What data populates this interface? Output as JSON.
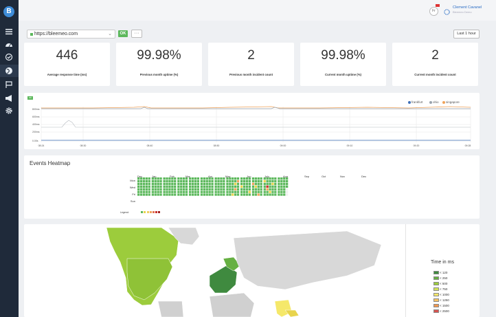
{
  "app": {
    "logo_text": "B",
    "user_name": "Clement Cavanel",
    "user_org": "Bleemeo Demo"
  },
  "sidebar": {
    "icons": [
      "menu-icon",
      "dashboard-icon",
      "check-circle-icon",
      "globe-icon",
      "flag-icon",
      "megaphone-icon",
      "gear-icon"
    ],
    "active": "globe-icon"
  },
  "controls": {
    "url_value": "https://bleemeo.com",
    "status": "OK",
    "more_label": "···",
    "time_range": "Last 1 hour"
  },
  "stats": [
    {
      "value": "446",
      "label": "Average response time (ms)"
    },
    {
      "value": "99.98%",
      "label": "Previous month uptime (%)"
    },
    {
      "value": "2",
      "label": "Previous month incident count"
    },
    {
      "value": "99.98%",
      "label": "Current month uptime (%)"
    },
    {
      "value": "2",
      "label": "Current month incident count"
    }
  ],
  "response_chart": {
    "status": "OK",
    "legend": [
      {
        "name": "frankfurt",
        "color": "#3e6fb8"
      },
      {
        "name": "ohio",
        "color": "#9aa3ad"
      },
      {
        "name": "singapore",
        "color": "#f0a35a"
      }
    ],
    "y_ticks": [
      "800ms",
      "600ms",
      "400ms",
      "200ms",
      "0.00s"
    ],
    "x_ticks": [
      "08:24",
      "08:30",
      "08:40",
      "08:50",
      "09:00",
      "09:10",
      "09:20",
      "09:28"
    ]
  },
  "heatmap": {
    "title": "Events Heatmap",
    "months": [
      "Dec",
      "Jan",
      "Feb",
      "Mar",
      "Apr",
      "May",
      "Jun",
      "July",
      "Aug",
      "Sep",
      "Oct",
      "Nov",
      "Dec"
    ],
    "days": [
      "Mon",
      "Wed",
      "Fri",
      "Sun"
    ],
    "legend_label": "Legend:",
    "colors": {
      "green": "#5cb85c",
      "yellow": "#e8d44d",
      "orange": "#f0a35a",
      "red": "#c9302c",
      "empty": "#f0f0f0"
    }
  },
  "map": {
    "legend_title": "Time in ms",
    "legend": [
      {
        "label": "< 120",
        "color": "#3f8a3f"
      },
      {
        "label": "< 250",
        "color": "#66b042"
      },
      {
        "label": "< 500",
        "color": "#9ccc3c"
      },
      {
        "label": "< 750",
        "color": "#d2e35a"
      },
      {
        "label": "< 1000",
        "color": "#f5e86a"
      },
      {
        "label": "< 1250",
        "color": "#f7c363"
      },
      {
        "label": "< 1500",
        "color": "#f2994f"
      },
      {
        "label": "< 2500",
        "color": "#d9534f"
      }
    ]
  }
}
